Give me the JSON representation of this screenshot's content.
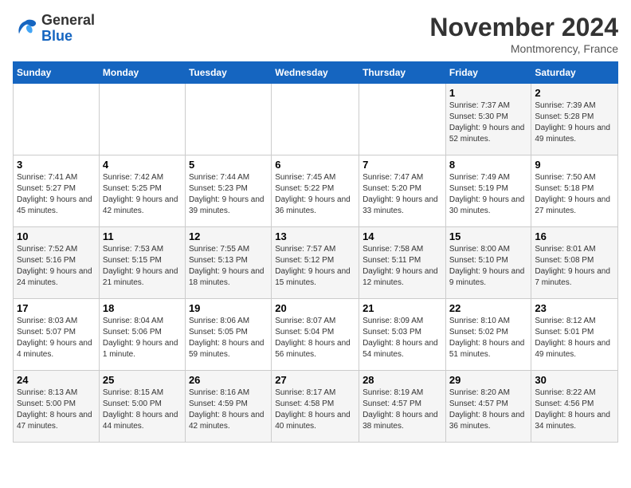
{
  "logo": {
    "line1": "General",
    "line2": "Blue"
  },
  "title": "November 2024",
  "subtitle": "Montmorency, France",
  "headers": [
    "Sunday",
    "Monday",
    "Tuesday",
    "Wednesday",
    "Thursday",
    "Friday",
    "Saturday"
  ],
  "weeks": [
    [
      {
        "day": "",
        "info": ""
      },
      {
        "day": "",
        "info": ""
      },
      {
        "day": "",
        "info": ""
      },
      {
        "day": "",
        "info": ""
      },
      {
        "day": "",
        "info": ""
      },
      {
        "day": "1",
        "info": "Sunrise: 7:37 AM\nSunset: 5:30 PM\nDaylight: 9 hours and 52 minutes."
      },
      {
        "day": "2",
        "info": "Sunrise: 7:39 AM\nSunset: 5:28 PM\nDaylight: 9 hours and 49 minutes."
      }
    ],
    [
      {
        "day": "3",
        "info": "Sunrise: 7:41 AM\nSunset: 5:27 PM\nDaylight: 9 hours and 45 minutes."
      },
      {
        "day": "4",
        "info": "Sunrise: 7:42 AM\nSunset: 5:25 PM\nDaylight: 9 hours and 42 minutes."
      },
      {
        "day": "5",
        "info": "Sunrise: 7:44 AM\nSunset: 5:23 PM\nDaylight: 9 hours and 39 minutes."
      },
      {
        "day": "6",
        "info": "Sunrise: 7:45 AM\nSunset: 5:22 PM\nDaylight: 9 hours and 36 minutes."
      },
      {
        "day": "7",
        "info": "Sunrise: 7:47 AM\nSunset: 5:20 PM\nDaylight: 9 hours and 33 minutes."
      },
      {
        "day": "8",
        "info": "Sunrise: 7:49 AM\nSunset: 5:19 PM\nDaylight: 9 hours and 30 minutes."
      },
      {
        "day": "9",
        "info": "Sunrise: 7:50 AM\nSunset: 5:18 PM\nDaylight: 9 hours and 27 minutes."
      }
    ],
    [
      {
        "day": "10",
        "info": "Sunrise: 7:52 AM\nSunset: 5:16 PM\nDaylight: 9 hours and 24 minutes."
      },
      {
        "day": "11",
        "info": "Sunrise: 7:53 AM\nSunset: 5:15 PM\nDaylight: 9 hours and 21 minutes."
      },
      {
        "day": "12",
        "info": "Sunrise: 7:55 AM\nSunset: 5:13 PM\nDaylight: 9 hours and 18 minutes."
      },
      {
        "day": "13",
        "info": "Sunrise: 7:57 AM\nSunset: 5:12 PM\nDaylight: 9 hours and 15 minutes."
      },
      {
        "day": "14",
        "info": "Sunrise: 7:58 AM\nSunset: 5:11 PM\nDaylight: 9 hours and 12 minutes."
      },
      {
        "day": "15",
        "info": "Sunrise: 8:00 AM\nSunset: 5:10 PM\nDaylight: 9 hours and 9 minutes."
      },
      {
        "day": "16",
        "info": "Sunrise: 8:01 AM\nSunset: 5:08 PM\nDaylight: 9 hours and 7 minutes."
      }
    ],
    [
      {
        "day": "17",
        "info": "Sunrise: 8:03 AM\nSunset: 5:07 PM\nDaylight: 9 hours and 4 minutes."
      },
      {
        "day": "18",
        "info": "Sunrise: 8:04 AM\nSunset: 5:06 PM\nDaylight: 9 hours and 1 minute."
      },
      {
        "day": "19",
        "info": "Sunrise: 8:06 AM\nSunset: 5:05 PM\nDaylight: 8 hours and 59 minutes."
      },
      {
        "day": "20",
        "info": "Sunrise: 8:07 AM\nSunset: 5:04 PM\nDaylight: 8 hours and 56 minutes."
      },
      {
        "day": "21",
        "info": "Sunrise: 8:09 AM\nSunset: 5:03 PM\nDaylight: 8 hours and 54 minutes."
      },
      {
        "day": "22",
        "info": "Sunrise: 8:10 AM\nSunset: 5:02 PM\nDaylight: 8 hours and 51 minutes."
      },
      {
        "day": "23",
        "info": "Sunrise: 8:12 AM\nSunset: 5:01 PM\nDaylight: 8 hours and 49 minutes."
      }
    ],
    [
      {
        "day": "24",
        "info": "Sunrise: 8:13 AM\nSunset: 5:00 PM\nDaylight: 8 hours and 47 minutes."
      },
      {
        "day": "25",
        "info": "Sunrise: 8:15 AM\nSunset: 5:00 PM\nDaylight: 8 hours and 44 minutes."
      },
      {
        "day": "26",
        "info": "Sunrise: 8:16 AM\nSunset: 4:59 PM\nDaylight: 8 hours and 42 minutes."
      },
      {
        "day": "27",
        "info": "Sunrise: 8:17 AM\nSunset: 4:58 PM\nDaylight: 8 hours and 40 minutes."
      },
      {
        "day": "28",
        "info": "Sunrise: 8:19 AM\nSunset: 4:57 PM\nDaylight: 8 hours and 38 minutes."
      },
      {
        "day": "29",
        "info": "Sunrise: 8:20 AM\nSunset: 4:57 PM\nDaylight: 8 hours and 36 minutes."
      },
      {
        "day": "30",
        "info": "Sunrise: 8:22 AM\nSunset: 4:56 PM\nDaylight: 8 hours and 34 minutes."
      }
    ]
  ]
}
